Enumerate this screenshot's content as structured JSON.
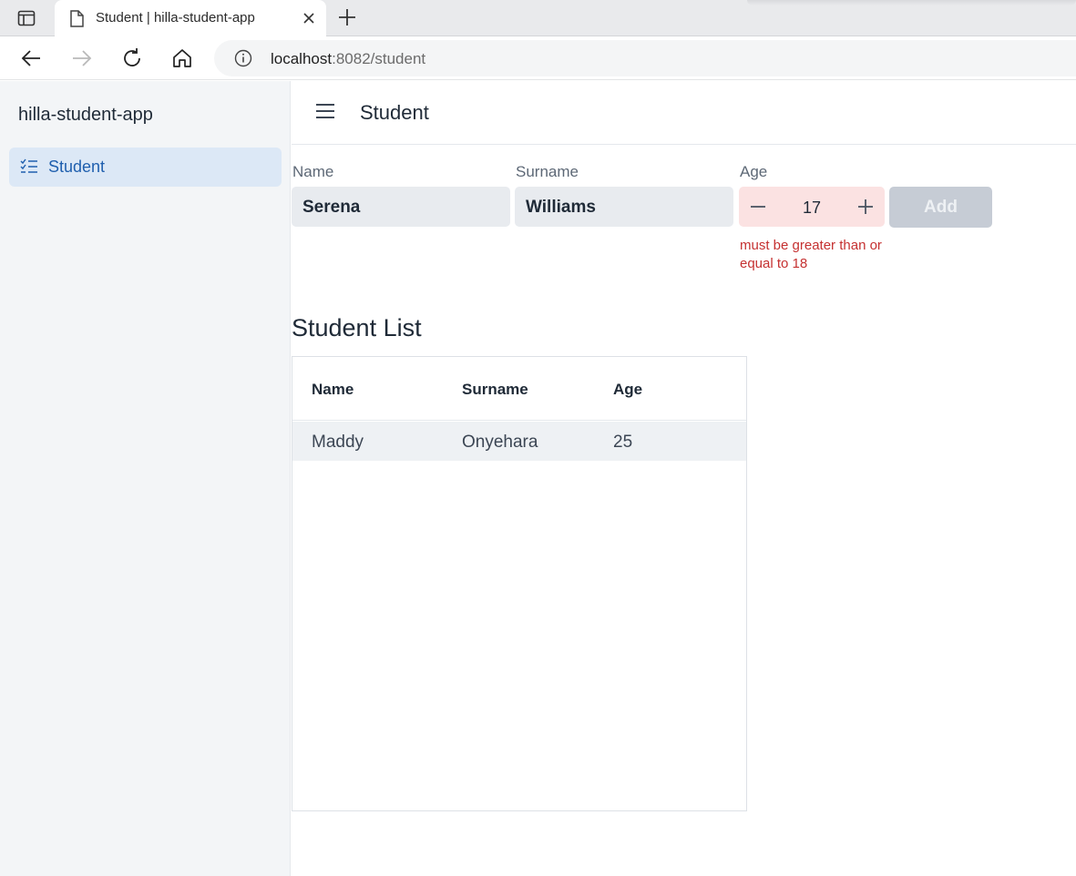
{
  "browser": {
    "tab_title": "Student | hilla-student-app",
    "url_host": "localhost",
    "url_path": ":8082/student"
  },
  "sidebar": {
    "app_title": "hilla-student-app",
    "items": [
      {
        "label": "Student",
        "icon": "checklist-icon"
      }
    ]
  },
  "header": {
    "title": "Student"
  },
  "form": {
    "name": {
      "label": "Name",
      "value": "Serena"
    },
    "surname": {
      "label": "Surname",
      "value": "Williams"
    },
    "age": {
      "label": "Age",
      "value": "17",
      "error": "must be greater than or equal to 18"
    },
    "add_label": "Add"
  },
  "list": {
    "title": "Student List",
    "columns": [
      "Name",
      "Surname",
      "Age"
    ],
    "rows": [
      [
        "Maddy",
        "Onyehara",
        "25"
      ]
    ]
  },
  "colors": {
    "accent": "#1f5fae",
    "error": "#c53030",
    "sidebar_bg": "#f3f5f7",
    "selected_nav_bg": "#dce8f6",
    "invalid_field_bg": "#fbe2e2"
  }
}
